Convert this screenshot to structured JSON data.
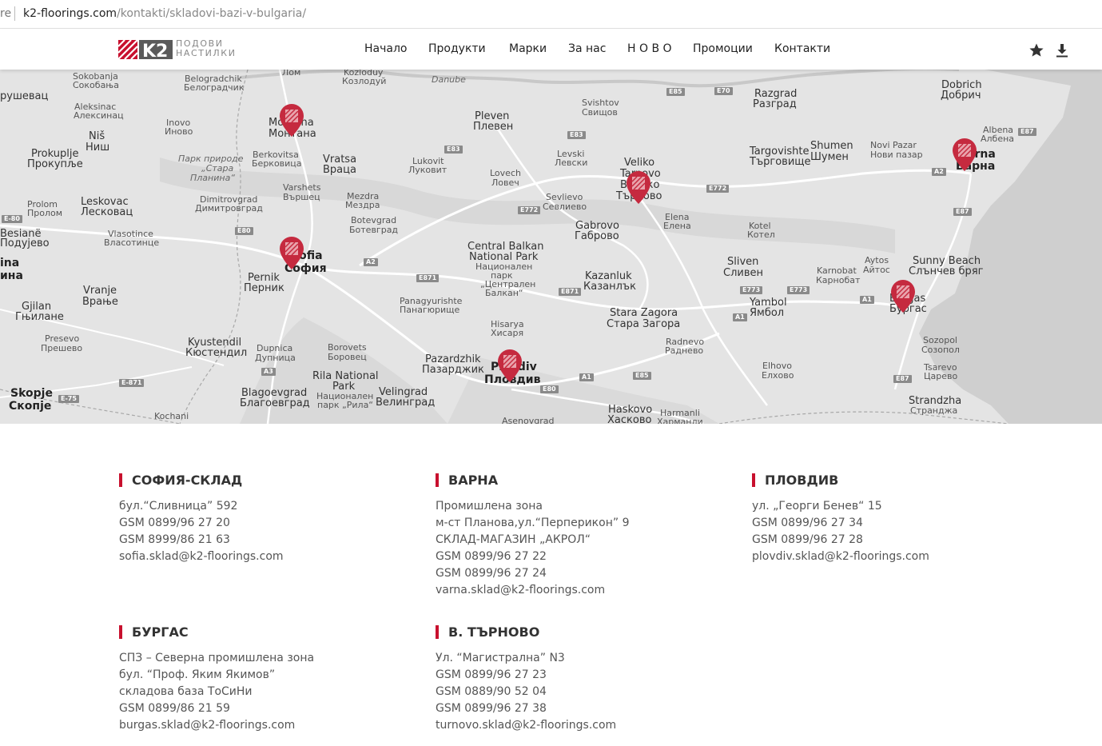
{
  "browser": {
    "url_prefix": "re",
    "url_domain": "k2-floorings.com",
    "url_path": "/kontakti/skladovi-bazi-v-bulgaria/"
  },
  "header": {
    "logo_text_line1": "ПОДОВИ",
    "logo_text_line2": "НАСТИЛКИ",
    "nav": [
      {
        "label": "Начало"
      },
      {
        "label": "Продукти"
      },
      {
        "label": "Марки"
      },
      {
        "label": "За нас"
      },
      {
        "label": "Н О В О"
      },
      {
        "label": "Промоции"
      },
      {
        "label": "Контакти"
      }
    ],
    "icons": [
      "star-icon",
      "download-icon"
    ]
  },
  "map": {
    "labels": [
      {
        "t": "Sokobanja"
      },
      {
        "t": "Сокобања"
      },
      {
        "t": "Belogradchik"
      },
      {
        "t": "Белоградчик"
      },
      {
        "t": "Лом"
      },
      {
        "t": "Kozloduy"
      },
      {
        "t": "Козлодуй"
      },
      {
        "t": "Danube"
      },
      {
        "t": "рушевац"
      },
      {
        "t": "Aleksinac"
      },
      {
        "t": "Алексинац"
      },
      {
        "t": "Niš"
      },
      {
        "t": "Ниш"
      },
      {
        "t": "Inovo"
      },
      {
        "t": "Иново"
      },
      {
        "t": "Montana"
      },
      {
        "t": "Монтана"
      },
      {
        "t": "Prokuplje"
      },
      {
        "t": "Прокупље"
      },
      {
        "t": "Berkovitsa"
      },
      {
        "t": "Берковица"
      },
      {
        "t": "Парк природе"
      },
      {
        "t": "„Стара"
      },
      {
        "t": "Планина“"
      },
      {
        "t": "Vratsa"
      },
      {
        "t": "Враца"
      },
      {
        "t": "Lukovit"
      },
      {
        "t": "Луковит"
      },
      {
        "t": "Pleven"
      },
      {
        "t": "Плевен"
      },
      {
        "t": "Svishtov"
      },
      {
        "t": "Свищов"
      },
      {
        "t": "Levski"
      },
      {
        "t": "Левски"
      },
      {
        "t": "Lovech"
      },
      {
        "t": "Ловеч"
      },
      {
        "t": "Veliko"
      },
      {
        "t": "Tarnovo"
      },
      {
        "t": "Велико"
      },
      {
        "t": "Търново"
      },
      {
        "t": "Razgrad"
      },
      {
        "t": "Разград"
      },
      {
        "t": "Targovishte"
      },
      {
        "t": "Търговище"
      },
      {
        "t": "Shumen"
      },
      {
        "t": "Шумен"
      },
      {
        "t": "Novi Pazar"
      },
      {
        "t": "Нови пазар"
      },
      {
        "t": "Dobrich"
      },
      {
        "t": "Добрич"
      },
      {
        "t": "Albena"
      },
      {
        "t": "Албена"
      },
      {
        "t": "Varna"
      },
      {
        "t": "Варна"
      },
      {
        "t": "Leskovac"
      },
      {
        "t": "Лесковац"
      },
      {
        "t": "Dimitrovgrad"
      },
      {
        "t": "Димитровград"
      },
      {
        "t": "Varshets"
      },
      {
        "t": "Вършец"
      },
      {
        "t": "Mezdra"
      },
      {
        "t": "Мездра"
      },
      {
        "t": "Sevlievo"
      },
      {
        "t": "Севлиево"
      },
      {
        "t": "Prolom"
      },
      {
        "t": "Пролом"
      },
      {
        "t": "Vlasotince"
      },
      {
        "t": "Власотинце"
      },
      {
        "t": "Botevgrad"
      },
      {
        "t": "Ботевград"
      },
      {
        "t": "Gabrovo"
      },
      {
        "t": "Габрово"
      },
      {
        "t": "Elena"
      },
      {
        "t": "Елена"
      },
      {
        "t": "Kotel"
      },
      {
        "t": "Котел"
      },
      {
        "t": "Besianë"
      },
      {
        "t": "Подујево"
      },
      {
        "t": "ina"
      },
      {
        "t": "ина"
      },
      {
        "t": "Sofia"
      },
      {
        "t": "София"
      },
      {
        "t": "Pernik"
      },
      {
        "t": "Перник"
      },
      {
        "t": "Central Balkan"
      },
      {
        "t": "National Park"
      },
      {
        "t": "Национален"
      },
      {
        "t": "парк"
      },
      {
        "t": "„Централен"
      },
      {
        "t": "Балкан“"
      },
      {
        "t": "Kazanluk"
      },
      {
        "t": "Казанлък"
      },
      {
        "t": "Sliven"
      },
      {
        "t": "Сливен"
      },
      {
        "t": "Aytos"
      },
      {
        "t": "Айтос"
      },
      {
        "t": "Karnobat"
      },
      {
        "t": "Карнобат"
      },
      {
        "t": "Sunny Beach"
      },
      {
        "t": "Слънчев бряг"
      },
      {
        "t": "Vranje"
      },
      {
        "t": "Врање"
      },
      {
        "t": "Panagyurishte"
      },
      {
        "t": "Панагюрище"
      },
      {
        "t": "Stara Zagora"
      },
      {
        "t": "Стара Загора"
      },
      {
        "t": "Yambol"
      },
      {
        "t": "Ямбол"
      },
      {
        "t": "Burgas"
      },
      {
        "t": "Бургас"
      },
      {
        "t": "Gjilan"
      },
      {
        "t": "Гњилане"
      },
      {
        "t": "Hisarya"
      },
      {
        "t": "Хисаря"
      },
      {
        "t": "Presevo"
      },
      {
        "t": "Прешево"
      },
      {
        "t": "Kyustendil"
      },
      {
        "t": "Кюстендил"
      },
      {
        "t": "Dupnica"
      },
      {
        "t": "Дупница"
      },
      {
        "t": "Borovets"
      },
      {
        "t": "Боровец"
      },
      {
        "t": "Radnevo"
      },
      {
        "t": "Раднево"
      },
      {
        "t": "Sozopol"
      },
      {
        "t": "Созопол"
      },
      {
        "t": "Pazardzhik"
      },
      {
        "t": "Пазарджик"
      },
      {
        "t": "Plovdiv"
      },
      {
        "t": "Пловдив"
      },
      {
        "t": "Rila National"
      },
      {
        "t": "Park"
      },
      {
        "t": "Национален"
      },
      {
        "t": "парк „Рила“"
      },
      {
        "t": "Elhovo"
      },
      {
        "t": "Елхово"
      },
      {
        "t": "Tsarevo"
      },
      {
        "t": "Царево"
      },
      {
        "t": "Skopje"
      },
      {
        "t": "Скопје"
      },
      {
        "t": "Blagoevgrad"
      },
      {
        "t": "Благоевград"
      },
      {
        "t": "Velingrad"
      },
      {
        "t": "Велинград"
      },
      {
        "t": "Haskovo"
      },
      {
        "t": "Хасково"
      },
      {
        "t": "Harmanli"
      },
      {
        "t": "Харманли"
      },
      {
        "t": "Strandzha"
      },
      {
        "t": "Странджа"
      },
      {
        "t": "Kochani"
      },
      {
        "t": "Asenovgrad"
      }
    ],
    "roads": [
      {
        "t": "E85"
      },
      {
        "t": "E70"
      },
      {
        "t": "E83"
      },
      {
        "t": "E83"
      },
      {
        "t": "E87"
      },
      {
        "t": "E772"
      },
      {
        "t": "E772"
      },
      {
        "t": "A2"
      },
      {
        "t": "E-80"
      },
      {
        "t": "E80"
      },
      {
        "t": "A2"
      },
      {
        "t": "E871"
      },
      {
        "t": "E871"
      },
      {
        "t": "E87"
      },
      {
        "t": "E773"
      },
      {
        "t": "E773"
      },
      {
        "t": "A1"
      },
      {
        "t": "A1"
      },
      {
        "t": "A3"
      },
      {
        "t": "E-871"
      },
      {
        "t": "E85"
      },
      {
        "t": "A1"
      },
      {
        "t": "E80"
      },
      {
        "t": "E87"
      },
      {
        "t": "E-75"
      }
    ]
  },
  "locations": [
    {
      "title": "СОФИЯ-СКЛАД",
      "lines": [
        "бул.“Сливница” 592",
        "GSM 0899/96 27 20",
        "GSM 8999/86 21 63",
        "sofia.sklad@k2-floorings.com"
      ]
    },
    {
      "title": "ВАРНА",
      "lines": [
        "Промишлена зона",
        "м-ст Планова,ул.“Перперикон” 9",
        "СКЛАД-МАГАЗИН „АКРОЛ“",
        "GSM 0899/96 27 22",
        "GSM 0899/96 27 24",
        "varna.sklad@k2-floorings.com"
      ]
    },
    {
      "title": "ПЛОВДИВ",
      "lines": [
        "ул. „Георги Бенев“ 15",
        "GSM 0899/96 27 34",
        "GSM 0899/96 27 28",
        "plovdiv.sklad@k2-floorings.com"
      ]
    },
    {
      "title": "БУРГАС",
      "lines": [
        "СПЗ – Северна промишлена зона",
        "бул. “Проф. Яким Якимов”",
        "складова база ТоСиНи",
        "GSM 0899/86 21 59",
        "burgas.sklad@k2-floorings.com"
      ]
    },
    {
      "title": "В. ТЪРНОВО",
      "lines": [
        "Ул. “Магистрална” N3",
        "GSM 0899/96 27 23",
        "GSM 0889/90 52 04",
        "GSM 0899/96 27 38",
        "turnovo.sklad@k2-floorings.com"
      ]
    }
  ],
  "colors": {
    "accent": "#c8102e",
    "pin": "#c52a3f",
    "map_bg": "#e6e6e6"
  }
}
